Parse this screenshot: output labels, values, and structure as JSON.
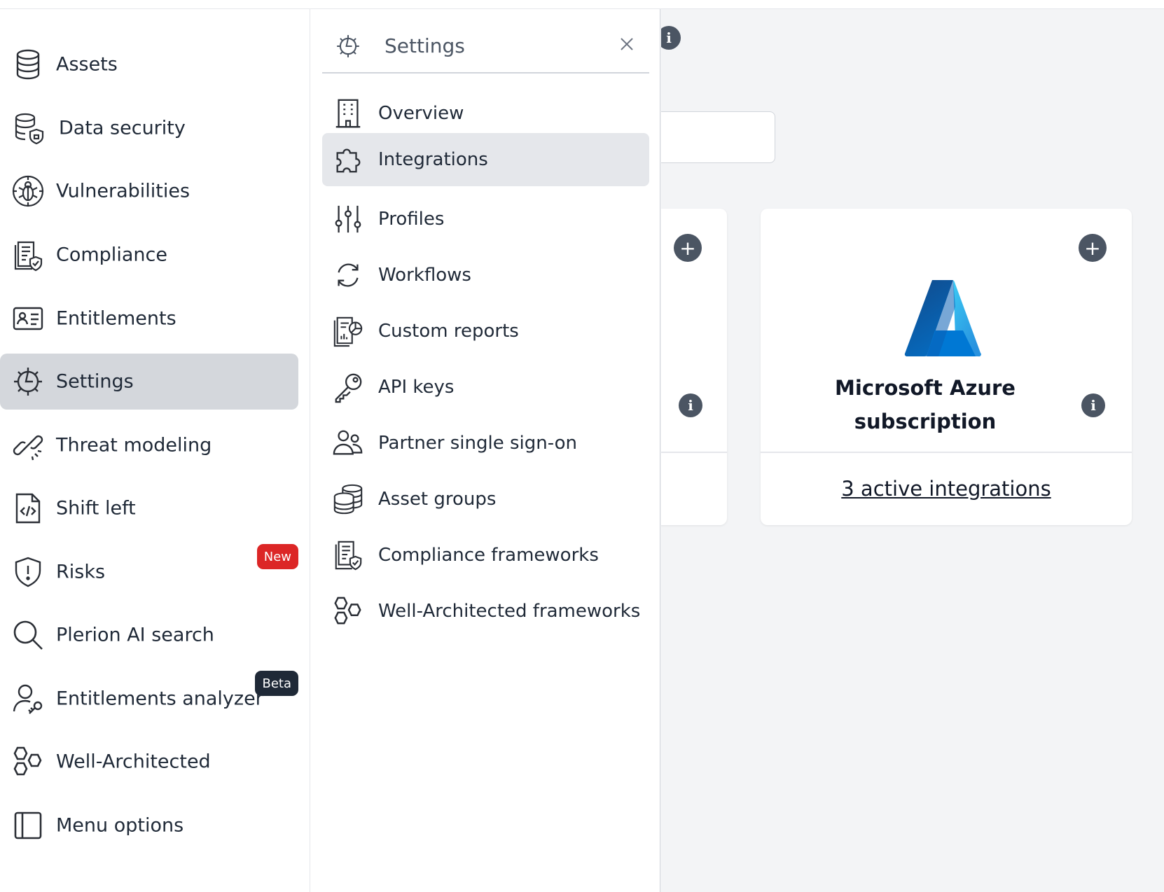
{
  "sidebar": {
    "items": [
      {
        "label": "Assets",
        "icon": "database-icon"
      },
      {
        "label": "Data security",
        "icon": "database-shield-icon"
      },
      {
        "label": "Vulnerabilities",
        "icon": "bug-icon"
      },
      {
        "label": "Compliance",
        "icon": "document-shield-icon"
      },
      {
        "label": "Entitlements",
        "icon": "id-card-icon"
      },
      {
        "label": "Settings",
        "icon": "gear-icon",
        "active": true
      },
      {
        "label": "Threat modeling",
        "icon": "broken-link-icon"
      },
      {
        "label": "Shift left",
        "icon": "code-file-icon"
      },
      {
        "label": "Risks",
        "icon": "shield-alert-icon",
        "badge": "New"
      },
      {
        "label": "Plerion AI search",
        "icon": "search-icon"
      },
      {
        "label": "Entitlements analyzer",
        "icon": "user-key-icon",
        "badge": "Beta"
      },
      {
        "label": "Well-Architected",
        "icon": "hexagons-icon"
      },
      {
        "label": "Menu options",
        "icon": "panel-icon"
      }
    ]
  },
  "settings_panel": {
    "title": "Settings",
    "items": [
      {
        "label": "Overview",
        "icon": "building-icon"
      },
      {
        "label": "Integrations",
        "icon": "puzzle-icon",
        "active": true
      },
      {
        "label": "Profiles",
        "icon": "sliders-icon"
      },
      {
        "label": "Workflows",
        "icon": "cycle-icon"
      },
      {
        "label": "Custom reports",
        "icon": "report-chart-icon"
      },
      {
        "label": "API keys",
        "icon": "key-icon"
      },
      {
        "label": "Partner single sign-on",
        "icon": "users-icon"
      },
      {
        "label": "Asset groups",
        "icon": "stacks-icon"
      },
      {
        "label": "Compliance frameworks",
        "icon": "document-shield-icon"
      },
      {
        "label": "Well-Architected frameworks",
        "icon": "hexagons-icon"
      }
    ]
  },
  "main": {
    "card_azure": {
      "title_line1": "Microsoft Azure",
      "title_line2": "subscription",
      "link": "3 active integrations"
    }
  },
  "colors": {
    "active_nav_bg": "#d4d7dc",
    "badge_new": "#dc2626",
    "badge_beta": "#1f2937",
    "azure_dark": "#0a5fb4",
    "azure_light": "#35c1f1"
  }
}
